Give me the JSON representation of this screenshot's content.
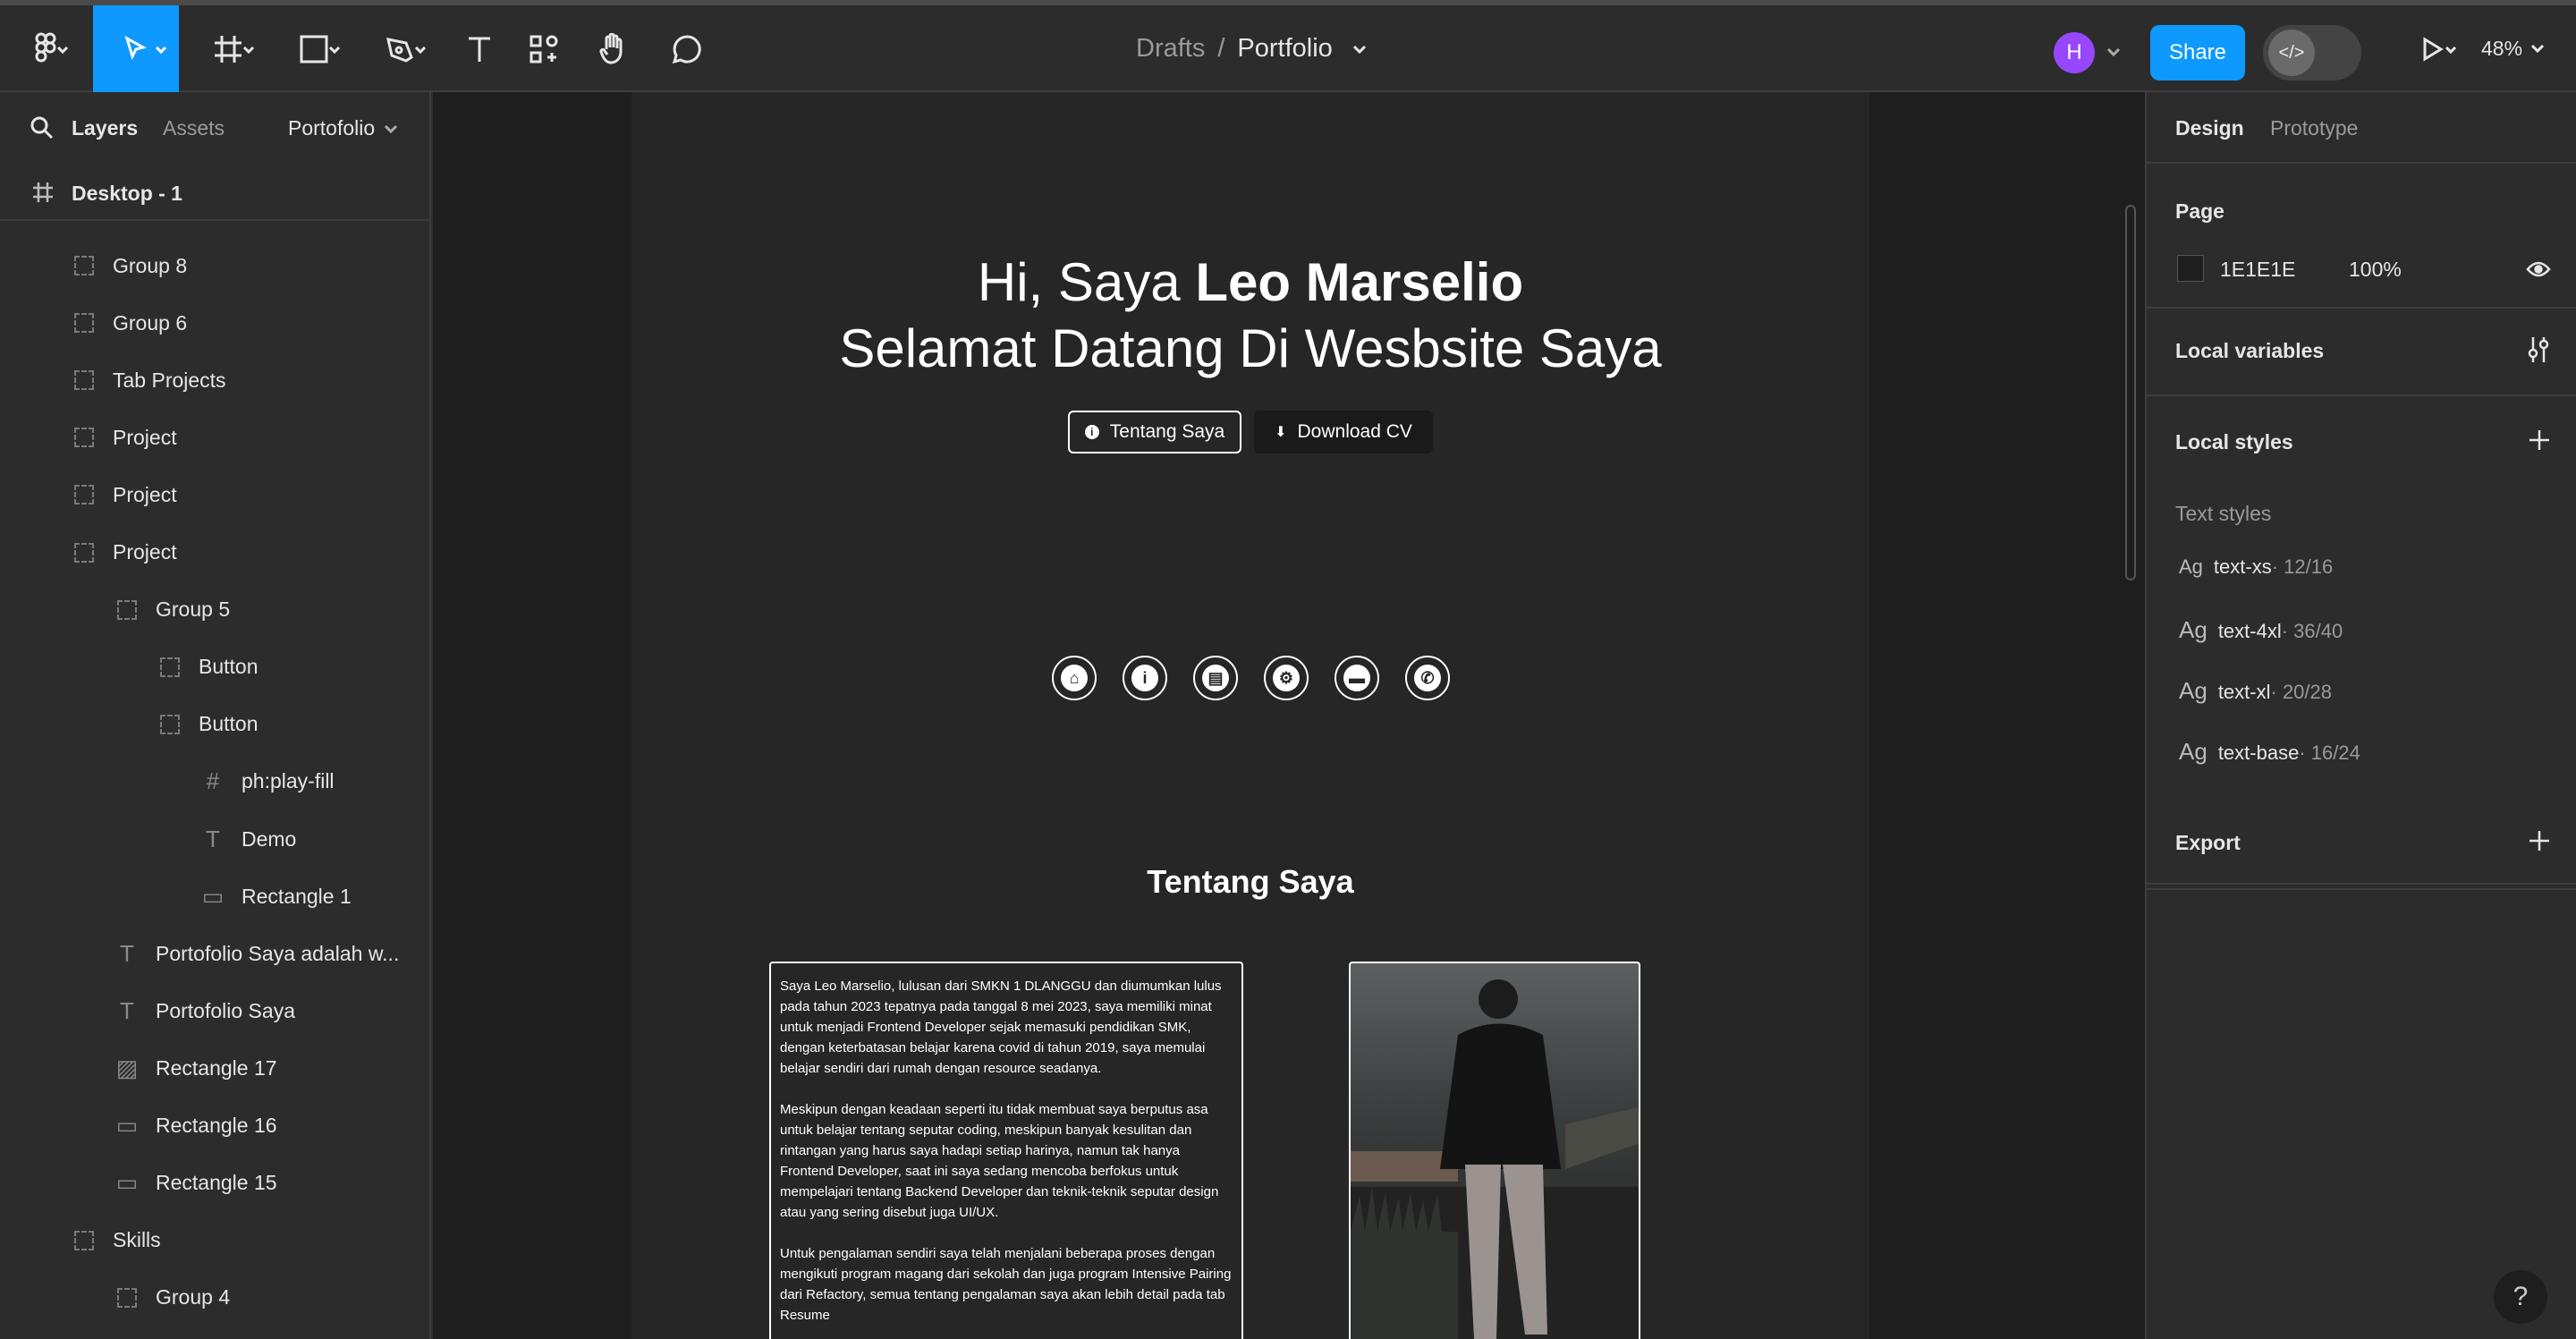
{
  "toolbar": {
    "breadcrumb_parent": "Drafts",
    "breadcrumb_sep": "/",
    "file_name": "Portfolio",
    "avatar_initial": "H",
    "share_label": "Share",
    "zoom": "48%",
    "accent": "#0d99ff"
  },
  "left_panel": {
    "tab_layers": "Layers",
    "tab_assets": "Assets",
    "page_name": "Portofolio",
    "frame_name": "Desktop - 1",
    "layers": [
      {
        "label": "Group 8",
        "icon": "group"
      },
      {
        "label": "Group 6",
        "icon": "group"
      },
      {
        "label": "Tab Projects",
        "icon": "group"
      },
      {
        "label": "Project",
        "icon": "group"
      },
      {
        "label": "Project",
        "icon": "group"
      },
      {
        "label": "Project",
        "icon": "group"
      },
      {
        "label": "Group 5",
        "icon": "group"
      },
      {
        "label": "Button",
        "icon": "group"
      },
      {
        "label": "Button",
        "icon": "group"
      },
      {
        "label": "ph:play-fill",
        "icon": "frame"
      },
      {
        "label": "Demo",
        "icon": "text"
      },
      {
        "label": "Rectangle 1",
        "icon": "rect"
      },
      {
        "label": "Portofolio Saya adalah w...",
        "icon": "text"
      },
      {
        "label": "Portofolio Saya",
        "icon": "text"
      },
      {
        "label": "Rectangle 17",
        "icon": "image"
      },
      {
        "label": "Rectangle 16",
        "icon": "rect"
      },
      {
        "label": "Rectangle 15",
        "icon": "rect"
      },
      {
        "label": "Skills",
        "icon": "group"
      },
      {
        "label": "Group 4",
        "icon": "group"
      }
    ]
  },
  "canvas": {
    "hero_line1_prefix": "Hi, Saya ",
    "hero_line1_name": "Leo Marselio",
    "hero_line2": "Selamat Datang Di Wesbsite Saya",
    "btn_about": "Tentang Saya",
    "btn_cv": "Download CV",
    "about_title": "Tentang Saya",
    "about_p1": "Saya Leo Marselio, lulusan dari SMKN 1 DLANGGU dan diumumkan lulus pada tahun 2023 tepatnya pada tanggal 8 mei 2023, saya memiliki minat untuk menjadi Frontend Developer sejak memasuki pendidikan SMK, dengan keterbatasan belajar karena covid di tahun 2019, saya memulai belajar sendiri dari rumah dengan resource seadanya.",
    "about_p2": "Meskipun dengan keadaan seperti itu tidak membuat saya berputus asa untuk belajar tentang seputar coding, meskipun banyak kesulitan dan rintangan yang harus saya hadapi setiap harinya, namun tak hanya Frontend Developer, saat ini saya sedang mencoba berfokus untuk mempelajari tentang Backend Developer dan teknik-teknik seputar design atau yang sering disebut juga UI/UX.",
    "about_p3": "Untuk pengalaman sendiri saya telah menjalani beberapa proses dengan mengikuti program magang dari sekolah dan juga program Intensive Pairing dari Refactory, semua tentang pengalaman saya akan lebih detail pada tab Resume"
  },
  "right_panel": {
    "tab_design": "Design",
    "tab_prototype": "Prototype",
    "page_label": "Page",
    "page_color": "1E1E1E",
    "page_opacity": "100%",
    "local_variables": "Local variables",
    "local_styles": "Local styles",
    "text_styles_label": "Text styles",
    "text_styles": [
      {
        "ag": "Ag",
        "name": "text-xs",
        "size": " · 12/16"
      },
      {
        "ag": "Ag",
        "name": "text-4xl",
        "size": " · 36/40"
      },
      {
        "ag": "Ag",
        "name": "text-xl",
        "size": " · 20/28"
      },
      {
        "ag": "Ag",
        "name": "text-base",
        "size": " · 16/24"
      }
    ],
    "export": "Export",
    "help": "?"
  }
}
